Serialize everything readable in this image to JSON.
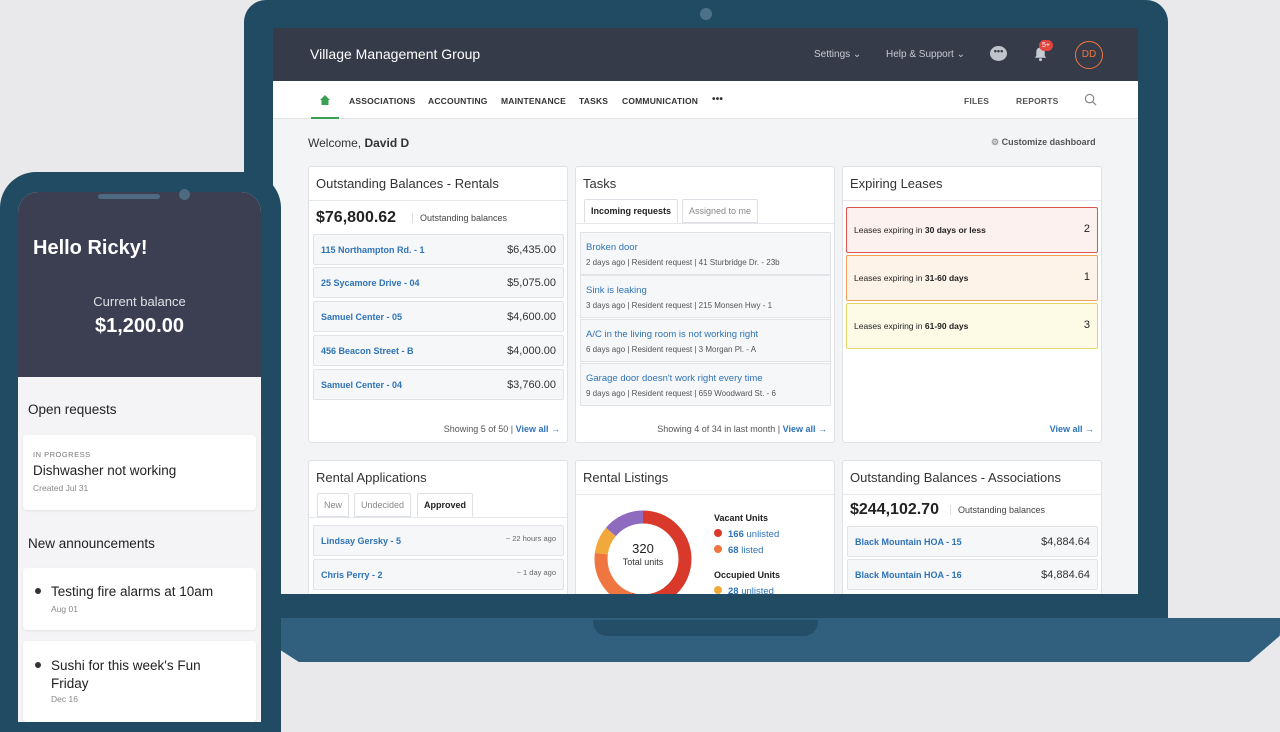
{
  "app": {
    "title": "Village Management Group",
    "settings": "Settings",
    "help": "Help & Support",
    "notif_badge": "5+",
    "avatar": "DD"
  },
  "nav": {
    "items": [
      "ASSOCIATIONS",
      "ACCOUNTING",
      "MAINTENANCE",
      "TASKS",
      "COMMUNICATION"
    ],
    "more": "•••",
    "files": "FILES",
    "reports": "REPORTS"
  },
  "welcome": {
    "prefix": "Welcome, ",
    "name": "David D",
    "customize": "Customize dashboard"
  },
  "balances_rentals": {
    "title": "Outstanding Balances - Rentals",
    "total": "$76,800.62",
    "label": "Outstanding balances",
    "rows": [
      {
        "name": "115 Northampton Rd. - 1",
        "amount": "$6,435.00"
      },
      {
        "name": "25 Sycamore Drive - 04",
        "amount": "$5,075.00"
      },
      {
        "name": "Samuel Center - 05",
        "amount": "$4,600.00"
      },
      {
        "name": "456 Beacon Street - B",
        "amount": "$4,000.00"
      },
      {
        "name": "Samuel Center - 04",
        "amount": "$3,760.00"
      }
    ],
    "footer": "Showing 5 of 50 |",
    "view_all": "View all →"
  },
  "tasks": {
    "title": "Tasks",
    "tab_incoming": "Incoming requests",
    "tab_assigned": "Assigned to me",
    "items": [
      {
        "title": "Broken door",
        "meta": "2 days ago | Resident request | 41 Sturbridge Dr. - 23b"
      },
      {
        "title": "Sink is leaking",
        "meta": "3 days ago | Resident request | 215 Monsen Hwy - 1"
      },
      {
        "title": "A/C in the living room is not working right",
        "meta": "6 days ago | Resident request | 3 Morgan Pl. - A"
      },
      {
        "title": "Garage door doesn't work right every time",
        "meta": "9 days ago | Resident request | 659 Woodward St. - 6"
      }
    ],
    "footer": "Showing 4 of 34 in last month |",
    "view_all": "View all →"
  },
  "leases": {
    "title": "Expiring Leases",
    "items": [
      {
        "pre": "Leases expiring in ",
        "bold": "30 days or less",
        "count": "2",
        "bg": "#fdf1ef",
        "border": "#d9534f"
      },
      {
        "pre": "Leases expiring in ",
        "bold": "31-60 days",
        "count": "1",
        "bg": "#fdf3e8",
        "border": "#f0a25a"
      },
      {
        "pre": "Leases expiring in ",
        "bold": "61-90 days",
        "count": "3",
        "bg": "#fdfbe6",
        "border": "#e6d66a"
      }
    ],
    "view_all": "View all →"
  },
  "applications": {
    "title": "Rental Applications",
    "tabs": [
      "New",
      "Undecided",
      "Approved"
    ],
    "rows": [
      {
        "name": "Lindsay Gersky - 5",
        "time": "~ 22 hours ago"
      },
      {
        "name": "Chris Perry - 2",
        "time": "~ 1 day ago"
      }
    ]
  },
  "listings": {
    "title": "Rental Listings",
    "total": "320",
    "total_label": "Total units",
    "vacant_label": "Vacant Units",
    "vacant": [
      {
        "count": "166",
        "label": "unlisted",
        "color": "#d9392b"
      },
      {
        "count": "68",
        "label": "listed",
        "color": "#f07641"
      }
    ],
    "occupied_label": "Occupied Units",
    "occupied": [
      {
        "count": "28",
        "label": "unlisted",
        "color": "#f2a93b"
      }
    ]
  },
  "balances_assoc": {
    "title": "Outstanding Balances - Associations",
    "total": "$244,102.70",
    "label": "Outstanding balances",
    "rows": [
      {
        "name": "Black Mountain HOA - 15",
        "amount": "$4,884.64"
      },
      {
        "name": "Black Mountain HOA - 16",
        "amount": "$4,884.64"
      }
    ]
  },
  "phone": {
    "greeting": "Hello Ricky!",
    "balance_label": "Current balance",
    "balance": "$1,200.00",
    "open_requests": "Open requests",
    "request": {
      "status": "IN PROGRESS",
      "title": "Dishwasher not working",
      "created": "Created Jul 31"
    },
    "announcements_title": "New announcements",
    "announcements": [
      {
        "title": "Testing fire alarms at 10am",
        "date": "Aug 01"
      },
      {
        "title": "Sushi for this week's Fun Friday",
        "date": "Dec 16"
      }
    ]
  }
}
